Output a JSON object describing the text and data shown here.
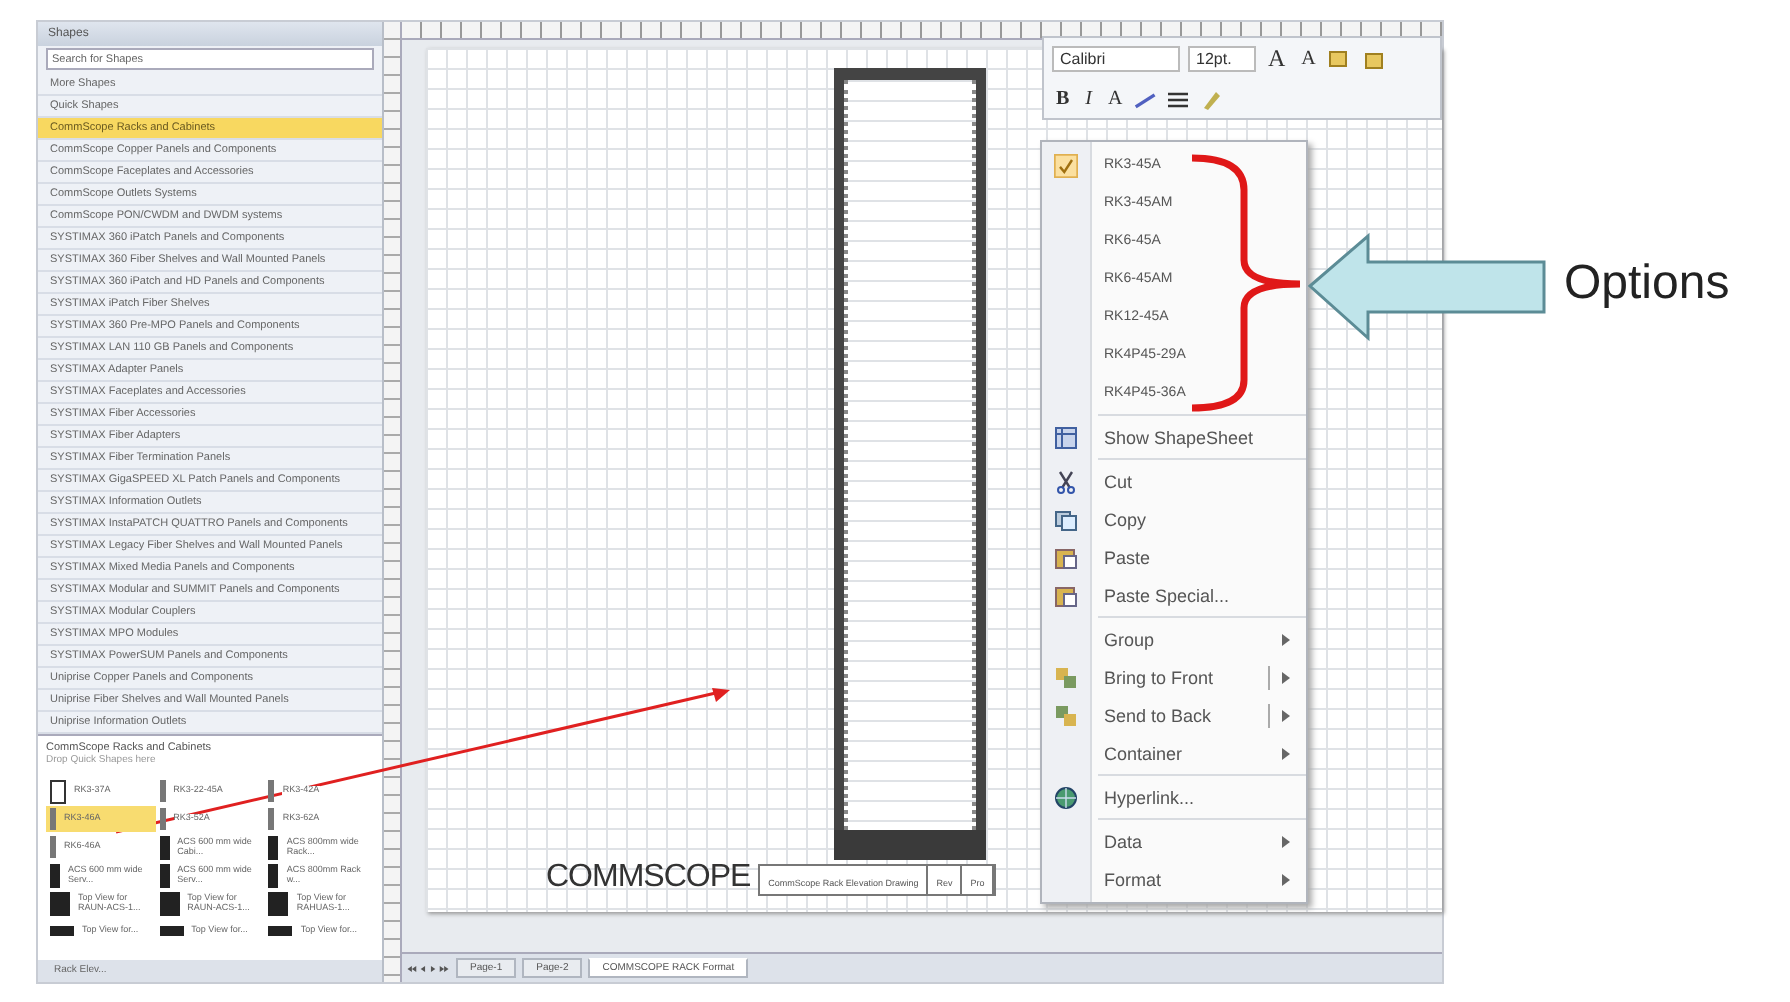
{
  "shapes_panel": {
    "title": "Shapes",
    "search": {
      "placeholder": "Search for Shapes"
    },
    "more_shapes": "More Shapes",
    "quick_shapes": "Quick Shapes",
    "stencils": [
      {
        "label": "CommScope Racks and Cabinets",
        "selected": true
      },
      {
        "label": "CommScope Copper Panels and Components",
        "selected": false
      },
      {
        "label": "CommScope Faceplates and Accessories",
        "selected": false
      },
      {
        "label": "CommScope Outlets Systems",
        "selected": false
      },
      {
        "label": "CommScope PON/CWDM and DWDM systems",
        "selected": false
      },
      {
        "label": "SYSTIMAX 360 iPatch Panels and Components",
        "selected": false
      },
      {
        "label": "SYSTIMAX 360 Fiber Shelves and Wall Mounted Panels",
        "selected": false
      },
      {
        "label": "SYSTIMAX 360 iPatch and HD Panels and Components",
        "selected": false
      },
      {
        "label": "SYSTIMAX iPatch Fiber Shelves",
        "selected": false
      },
      {
        "label": "SYSTIMAX 360 Pre-MPO Panels and Components",
        "selected": false
      },
      {
        "label": "SYSTIMAX LAN 110 GB Panels and Components",
        "selected": false
      },
      {
        "label": "SYSTIMAX Adapter Panels",
        "selected": false
      },
      {
        "label": "SYSTIMAX Faceplates and Accessories",
        "selected": false
      },
      {
        "label": "SYSTIMAX Fiber Accessories",
        "selected": false
      },
      {
        "label": "SYSTIMAX Fiber Adapters",
        "selected": false
      },
      {
        "label": "SYSTIMAX Fiber Termination Panels",
        "selected": false
      },
      {
        "label": "SYSTIMAX GigaSPEED XL Patch Panels and Components",
        "selected": false
      },
      {
        "label": "SYSTIMAX Information Outlets",
        "selected": false
      },
      {
        "label": "SYSTIMAX InstaPATCH QUATTRO Panels and Components",
        "selected": false
      },
      {
        "label": "SYSTIMAX Legacy Fiber Shelves and Wall Mounted Panels",
        "selected": false
      },
      {
        "label": "SYSTIMAX Mixed Media Panels and Components",
        "selected": false
      },
      {
        "label": "SYSTIMAX Modular and SUMMIT Panels and Components",
        "selected": false
      },
      {
        "label": "SYSTIMAX Modular Couplers",
        "selected": false
      },
      {
        "label": "SYSTIMAX MPO Modules",
        "selected": false
      },
      {
        "label": "SYSTIMAX PowerSUM Panels and Components",
        "selected": false
      },
      {
        "label": "Uniprise Copper Panels and Components",
        "selected": false
      },
      {
        "label": "Uniprise Fiber Shelves and Wall Mounted Panels",
        "selected": false
      },
      {
        "label": "Uniprise Information Outlets",
        "selected": false
      }
    ],
    "stencil_title": "CommScope Racks and Cabinets",
    "stencil_hint": "Drop Quick Shapes here",
    "masters": [
      {
        "label": "RK3-37A",
        "kind": "outline",
        "selected": false
      },
      {
        "label": "RK3-22-45A",
        "kind": "narrow",
        "selected": false
      },
      {
        "label": "RK3-42A",
        "kind": "narrow",
        "selected": false
      },
      {
        "label": "RK3-46A",
        "kind": "narrow",
        "selected": true
      },
      {
        "label": "RK3-52A",
        "kind": "narrow",
        "selected": false
      },
      {
        "label": "RK3-62A",
        "kind": "narrow",
        "selected": false
      },
      {
        "label": "RK6-46A",
        "kind": "narrow",
        "selected": false
      },
      {
        "label": "ACS 600 mm wide Cabi...",
        "kind": "solid",
        "selected": false
      },
      {
        "label": "ACS 800mm wide Rack...",
        "kind": "solid",
        "selected": false
      },
      {
        "label": "ACS 600 mm wide Serv...",
        "kind": "solid",
        "selected": false
      },
      {
        "label": "ACS 600 mm wide Serv...",
        "kind": "solid",
        "selected": false
      },
      {
        "label": "ACS 800mm Rack w...",
        "kind": "solid",
        "selected": false
      },
      {
        "label": "Top View for RAUN-ACS-1...",
        "kind": "block",
        "selected": false
      },
      {
        "label": "Top View for RAUN-ACS-1...",
        "kind": "block",
        "selected": false
      },
      {
        "label": "Top View for RAHUAS-1...",
        "kind": "block",
        "selected": false
      },
      {
        "label": "Top View for...",
        "kind": "wide",
        "selected": false
      },
      {
        "label": "Top View for...",
        "kind": "wide",
        "selected": false
      },
      {
        "label": "Top View for...",
        "kind": "wide",
        "selected": false
      }
    ],
    "footer_tab": "Rack Elev..."
  },
  "mini_toolbar": {
    "font": "Calibri",
    "size": "12pt.",
    "grow": "A",
    "shrink": "A",
    "bold": "B",
    "italic": "I",
    "font_color": "A"
  },
  "context_menu": {
    "items": [
      {
        "kind": "option",
        "label": "RK3-45A",
        "checked": true
      },
      {
        "kind": "option",
        "label": "RK3-45AM",
        "checked": false
      },
      {
        "kind": "option",
        "label": "RK6-45A",
        "checked": false
      },
      {
        "kind": "option",
        "label": "RK6-45AM",
        "checked": false
      },
      {
        "kind": "option",
        "label": "RK12-45A",
        "checked": false
      },
      {
        "kind": "option",
        "label": "RK4P45-29A",
        "checked": false
      },
      {
        "kind": "option",
        "label": "RK4P45-36A",
        "checked": false
      },
      {
        "kind": "separator"
      },
      {
        "kind": "command",
        "label": "Show ShapeSheet"
      },
      {
        "kind": "separator"
      },
      {
        "kind": "command",
        "label": "Cut"
      },
      {
        "kind": "command",
        "label": "Copy"
      },
      {
        "kind": "command",
        "label": "Paste"
      },
      {
        "kind": "command",
        "label": "Paste Special..."
      },
      {
        "kind": "separator"
      },
      {
        "kind": "submenu",
        "label": "Group",
        "split": false
      },
      {
        "kind": "submenu",
        "label": "Bring to Front",
        "split": true
      },
      {
        "kind": "submenu",
        "label": "Send to Back",
        "split": true
      },
      {
        "kind": "submenu",
        "label": "Container",
        "split": false
      },
      {
        "kind": "separator"
      },
      {
        "kind": "command",
        "label": "Hyperlink..."
      },
      {
        "kind": "separator"
      },
      {
        "kind": "submenu",
        "label": "Data",
        "split": false
      },
      {
        "kind": "submenu",
        "label": "Format",
        "split": false
      }
    ]
  },
  "drawing": {
    "logo": "COMMSCOPE",
    "title_block": [
      "CommScope Rack Elevation Drawing",
      "Rev",
      "Pro"
    ]
  },
  "page_tabs": [
    {
      "label": "Page-1",
      "selected": false
    },
    {
      "label": "Page-2",
      "selected": false
    },
    {
      "label": "COMMSCOPE RACK Format",
      "selected": true
    }
  ],
  "annotation": {
    "label": "Options"
  }
}
